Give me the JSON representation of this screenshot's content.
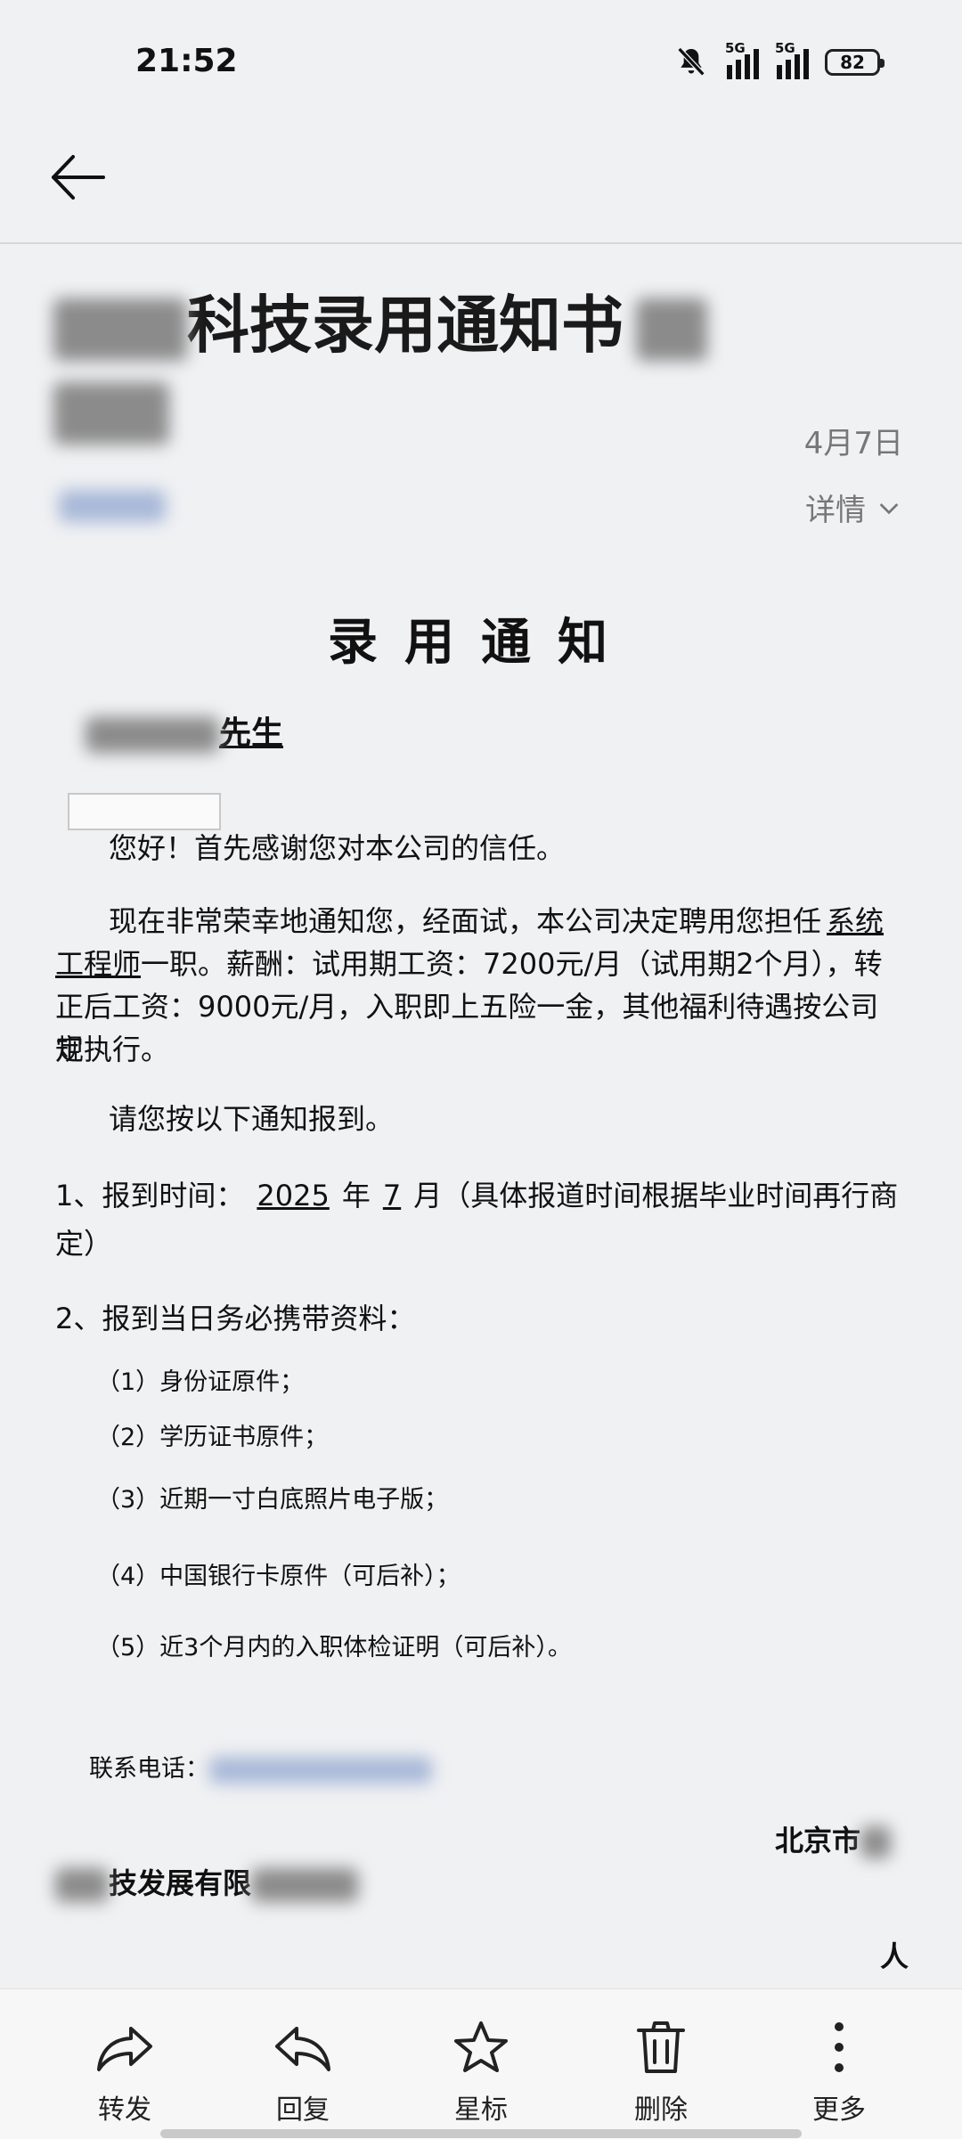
{
  "status": {
    "time": "21:52",
    "network1": "5G",
    "network2": "5G",
    "battery": "82"
  },
  "email": {
    "subject": "科技录用通知书",
    "date": "4月7日",
    "details_label": "详情"
  },
  "letter": {
    "title": "录用通知",
    "salutation_suffix": "先生",
    "greeting": "您好！首先感谢您对本公司的信任。",
    "p1_a": "现在非常荣幸地通知您，经面试，本公司决定聘用您担任",
    "p1_role_a": "系统",
    "p1_role_b": "工程师",
    "p1_b": "一职。薪酬：试用期工资：7200元/月（试用期2个月），转",
    "p1_c": "正后工资：9000元/月，入职即上五险一金，其他福利待遇按公司规",
    "p1_d": "定执行。",
    "p2": "请您按以下通知报到。",
    "item1_a": "1、报到时间：",
    "item1_year": "2025",
    "item1_b": "年",
    "item1_month": "7",
    "item1_c": "月（具体报道时间根据毕业时间再行商",
    "item1_d": "定）",
    "item2": "2、报到当日务必携带资料：",
    "materials": [
      "（1）身份证原件；",
      "（2）学历证书原件；",
      "（3）近期一寸白底照片电子版；",
      "（4）中国银行卡原件（可后补）；",
      "（5）近3个月内的入职体检证明（可后补）。"
    ],
    "phone_label": "联系电话：",
    "city": "北京市",
    "company_partial": "技发展有限",
    "person_char": "人"
  },
  "toolbar": {
    "forward": "转发",
    "reply": "回复",
    "star": "星标",
    "delete": "删除",
    "more": "更多"
  }
}
